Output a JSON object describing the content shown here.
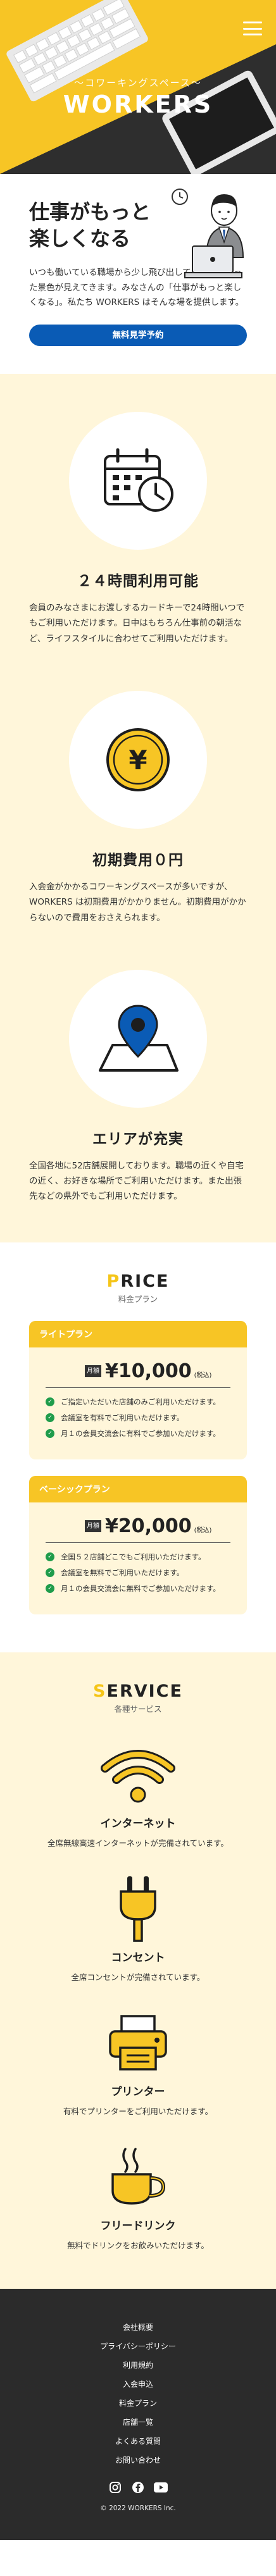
{
  "header": {
    "subtitle": "〜コワーキングスペース〜",
    "title": "WORKERS",
    "menu_icon": "hamburger-menu-icon"
  },
  "intro": {
    "title_line1": "仕事がもっと",
    "title_line2": "楽しくなる",
    "text": "いつも働いている職場から少し飛び出してみると、違った景色が見えてきます。みなさんの「仕事がもっと楽しくなる」。私たち WORKERS はそんな場を提供します。",
    "cta_label": "無料見学予約"
  },
  "features": [
    {
      "icon": "calendar-clock-icon",
      "title": "２４時間利用可能",
      "text": "会員のみなさまにお渡しするカードキーで24時間いつでもご利用いただけます。日中はもちろん仕事前の朝活など、ライフスタイルに合わせてご利用いただけます。"
    },
    {
      "icon": "yen-coin-icon",
      "title": "初期費用０円",
      "text": "入会金がかかるコワーキングスペースが多いですが、WORKERS は初期費用がかかりません。初期費用がかからないので費用をおさえられます。"
    },
    {
      "icon": "map-pin-icon",
      "title": "エリアが充実",
      "text": "全国各地に52店舗展開しております。職場の近くや自宅の近く、お好きな場所でご利用いただけます。また出張先などの県外でもご利用いただけます。"
    }
  ],
  "price": {
    "title_first": "P",
    "title_rest": "RICE",
    "subtitle": "料金プラン",
    "plans": [
      {
        "name": "ライトプラン",
        "tag": "月額",
        "amount": "¥10,000",
        "tax": "(税込)",
        "items": [
          "ご指定いただいた店舗のみご利用いただけます。",
          "会議室を有料でご利用いただけます。",
          "月１の会員交流会に有料でご参加いただけます。"
        ]
      },
      {
        "name": "ベーシックプラン",
        "tag": "月額",
        "amount": "¥20,000",
        "tax": "(税込)",
        "items": [
          "全国５２店舗どこでもご利用いただけます。",
          "会議室を無料でご利用いただけます。",
          "月１の会員交流会に無料でご参加いただけます。"
        ]
      }
    ]
  },
  "service": {
    "title_first": "S",
    "title_rest": "ERVICE",
    "subtitle": "各種サービス",
    "items": [
      {
        "icon": "wifi-icon",
        "title": "インターネット",
        "text": "全席無線高速インターネットが完備されています。"
      },
      {
        "icon": "power-plug-icon",
        "title": "コンセント",
        "text": "全席コンセントが完備されています。"
      },
      {
        "icon": "printer-icon",
        "title": "プリンター",
        "text": "有料でプリンターをご利用いただけます。"
      },
      {
        "icon": "coffee-cup-icon",
        "title": "フリードリンク",
        "text": "無料でドリンクをお飲みいただけます。"
      }
    ]
  },
  "footer": {
    "links": [
      "会社概要",
      "プライバシーポリシー",
      "利用規約",
      "入会申込",
      "料金プラン",
      "店舗一覧",
      "よくある質問",
      "お問い合わせ"
    ],
    "copyright": "© 2022 WORKERS Inc."
  },
  "colors": {
    "accent": "#f7c525",
    "cream": "#fff6da",
    "button": "#0a5bb5",
    "footer": "#2b2b2b",
    "check": "#1f9c4b"
  }
}
